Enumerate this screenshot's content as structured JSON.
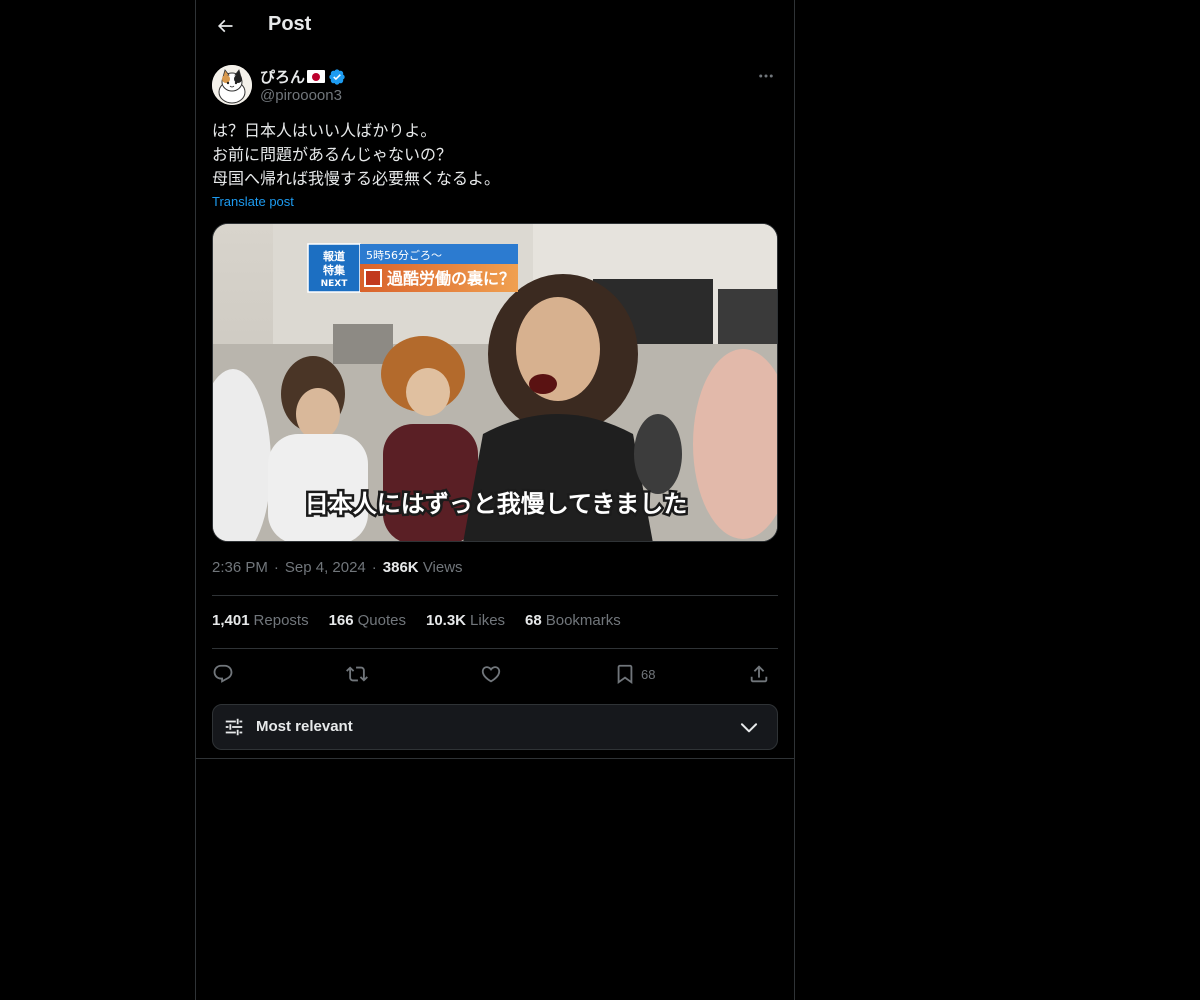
{
  "header": {
    "title": "Post"
  },
  "author": {
    "display_name": "ぴろん",
    "handle": "@piroooon3",
    "verified": true
  },
  "tweet": {
    "lines": [
      "は？日本人はいい人ばかりよ。",
      "お前に問題があるんじゃないの？",
      "母国へ帰れば我慢する必要無くなるよ。"
    ],
    "translate_label": "Translate post"
  },
  "media": {
    "news_banner": {
      "logo_line1": "報道",
      "logo_line2": "特集",
      "logo_line3": "NEXT",
      "time_text": "5時56分ごろ～",
      "headline": "過酷労働の裏に？"
    },
    "caption": "日本人にはずっと我慢してきました"
  },
  "meta": {
    "time": "2:36 PM",
    "date": "Sep 4, 2024",
    "views_count": "386K",
    "views_label": "Views"
  },
  "stats": {
    "reposts_count": "1,401",
    "reposts_label": "Reposts",
    "quotes_count": "166",
    "quotes_label": "Quotes",
    "likes_count": "10.3K",
    "likes_label": "Likes",
    "bookmarks_count": "68",
    "bookmarks_label": "Bookmarks"
  },
  "actions": {
    "bookmark_count": "68"
  },
  "sort": {
    "label": "Most relevant"
  },
  "icons": {
    "back": "arrow-left-icon",
    "verified": "verified-badge-icon",
    "more": "more-horizontal-icon",
    "reply": "reply-icon",
    "repost": "repost-icon",
    "like": "heart-icon",
    "bookmark": "bookmark-icon",
    "share": "share-icon",
    "sort": "sliders-icon",
    "chevron": "chevron-down-icon"
  },
  "colors": {
    "background": "#000000",
    "text_primary": "#e7e9ea",
    "text_secondary": "#71767b",
    "accent": "#1d9bf0",
    "border": "#2f3336",
    "sort_bar_bg": "#16181c"
  }
}
